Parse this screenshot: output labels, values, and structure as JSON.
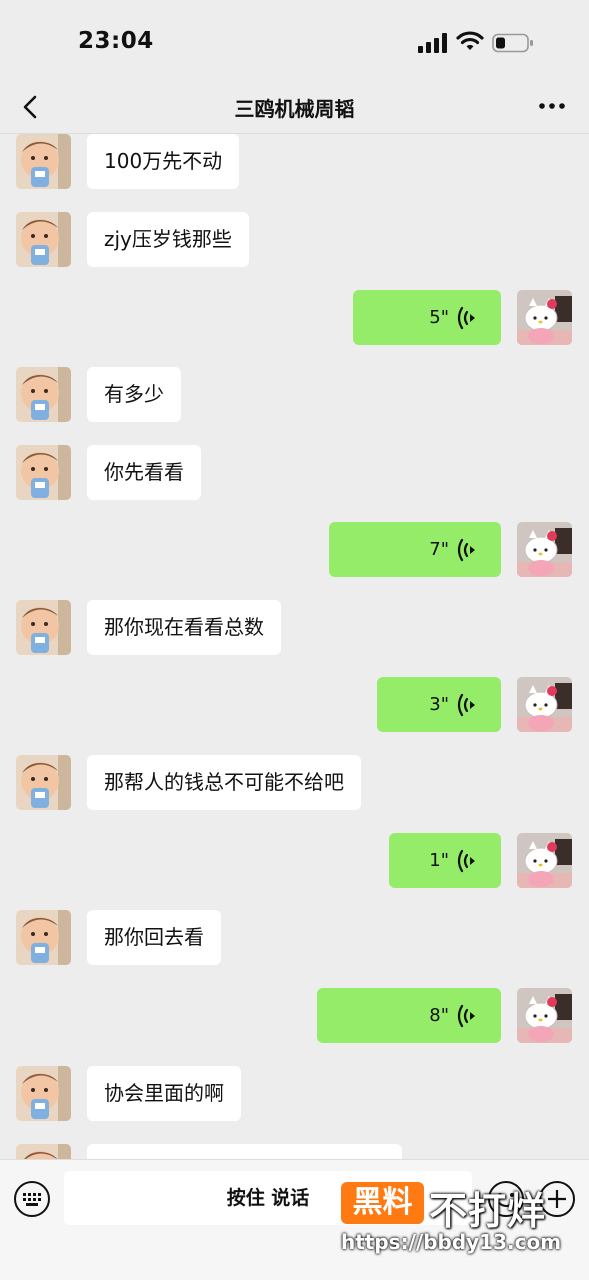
{
  "status_bar": {
    "time": "23:04"
  },
  "nav": {
    "title": "三鸥机械周韬"
  },
  "messages": [
    {
      "side": "left",
      "type": "text",
      "text": "100万先不动"
    },
    {
      "side": "left",
      "type": "text",
      "text": "zjy压岁钱那些"
    },
    {
      "side": "right",
      "type": "voice",
      "duration": "5\""
    },
    {
      "side": "left",
      "type": "text",
      "text": "有多少"
    },
    {
      "side": "left",
      "type": "text",
      "text": "你先看看"
    },
    {
      "side": "right",
      "type": "voice",
      "duration": "7\""
    },
    {
      "side": "left",
      "type": "text",
      "text": "那你现在看看总数"
    },
    {
      "side": "right",
      "type": "voice",
      "duration": "3\""
    },
    {
      "side": "left",
      "type": "text",
      "text": "那帮人的钱总不可能不给吧"
    },
    {
      "side": "right",
      "type": "voice",
      "duration": "1\""
    },
    {
      "side": "left",
      "type": "text",
      "text": "那你回去看"
    },
    {
      "side": "right",
      "type": "voice",
      "duration": "8\""
    },
    {
      "side": "left",
      "type": "text",
      "text": "协会里面的啊"
    },
    {
      "side": "left",
      "type": "text",
      "text": ""
    }
  ],
  "input_bar": {
    "hold_to_talk": "按住 说话"
  },
  "watermark": {
    "badge": "黑料",
    "text": "不打烊",
    "url": "https://bbdy13.com"
  },
  "colors": {
    "background": "#ededed",
    "self_bubble": "#95ec69",
    "other_bubble": "#ffffff",
    "watermark_orange": "#ff7a12"
  },
  "icons": {
    "back": "chevron-left-icon",
    "more": "more-dots-icon",
    "keyboard": "keyboard-icon",
    "emoji": "emoji-icon",
    "plus": "plus-icon",
    "voice": "voice-wave-icon"
  }
}
